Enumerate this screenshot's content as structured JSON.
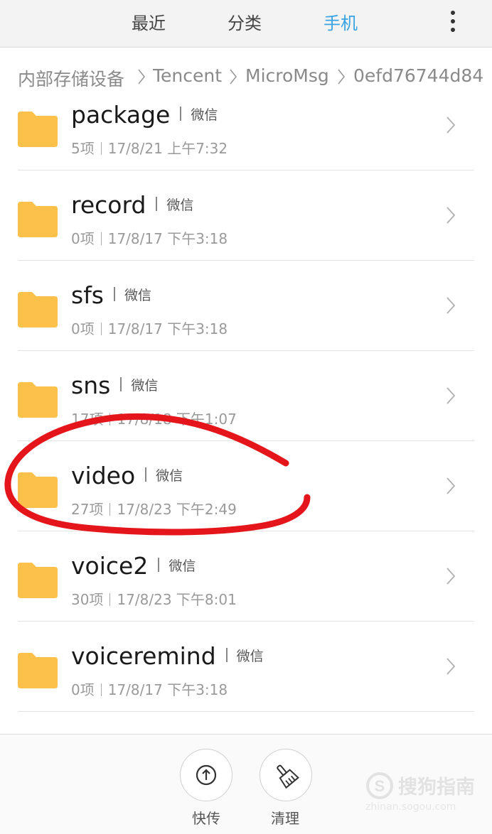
{
  "tabs": [
    {
      "label": "最近",
      "active": false
    },
    {
      "label": "分类",
      "active": false
    },
    {
      "label": "手机",
      "active": true
    }
  ],
  "accent_color": "#3aa3e3",
  "folder_color": "#fcc14a",
  "annotation_color": "#e5161b",
  "more_icon": "vertical-dots-icon",
  "breadcrumb": [
    "内部存储设备",
    "Tencent",
    "MicroMsg",
    "0efd76744d84"
  ],
  "folders": [
    {
      "name": "package",
      "source": "微信",
      "count": "5项",
      "date": "17/8/21 上午7:32"
    },
    {
      "name": "record",
      "source": "微信",
      "count": "0项",
      "date": "17/8/17 下午3:18"
    },
    {
      "name": "sfs",
      "source": "微信",
      "count": "0项",
      "date": "17/8/17 下午3:18"
    },
    {
      "name": "sns",
      "source": "微信",
      "count": "17项",
      "date": "17/8/18 下午1:07"
    },
    {
      "name": "video",
      "source": "微信",
      "count": "27项",
      "date": "17/8/23 下午2:49"
    },
    {
      "name": "voice2",
      "source": "微信",
      "count": "30项",
      "date": "17/8/23 下午8:01"
    },
    {
      "name": "voiceremind",
      "source": "微信",
      "count": "0项",
      "date": "17/8/17 下午3:18"
    }
  ],
  "bottom": {
    "transfer_label": "快传",
    "clean_label": "清理"
  },
  "watermark": {
    "text": "搜狗指南",
    "url": "zhinan.sogou.com"
  }
}
